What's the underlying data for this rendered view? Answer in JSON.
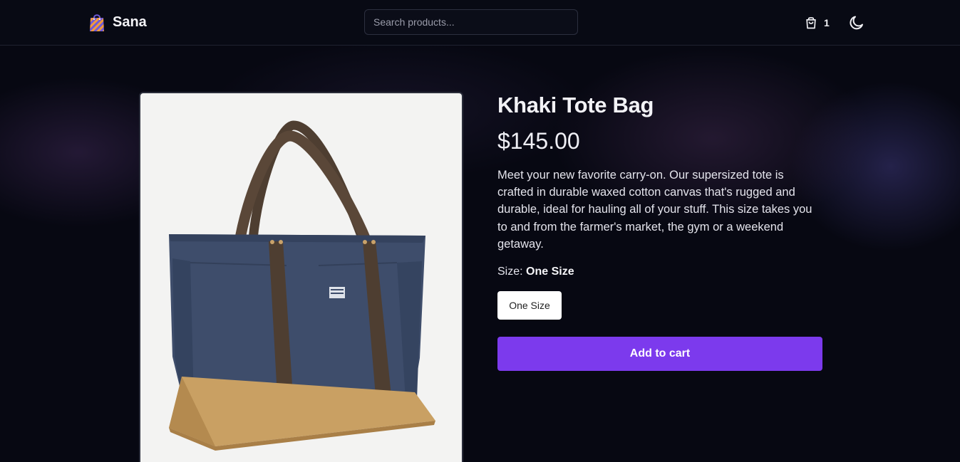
{
  "header": {
    "brand_name": "Sana",
    "brand_logo_icon": "shopping-bag-logo-icon",
    "search": {
      "placeholder": "Search products...",
      "value": ""
    },
    "cart": {
      "icon": "shopping-bag-icon",
      "count": "1"
    },
    "theme_toggle": {
      "icon": "moon-icon"
    }
  },
  "product": {
    "title": "Khaki Tote Bag",
    "price": "$145.00",
    "description": "Meet your new favorite carry-on. Our supersized tote is crafted in durable waxed cotton canvas that's rugged and durable, ideal for hauling all of your stuff. This size takes you to and from the farmer's market, the gym or a weekend getaway.",
    "size_label": "Size:",
    "selected_size": "One Size",
    "size_options": [
      "One Size"
    ],
    "add_to_cart_label": "Add to cart"
  },
  "colors": {
    "background": "#070812",
    "accent": "#7c3aed",
    "bag_body": "#3e4d6b",
    "bag_base": "#c9a063",
    "bag_strap": "#4e3e31"
  }
}
